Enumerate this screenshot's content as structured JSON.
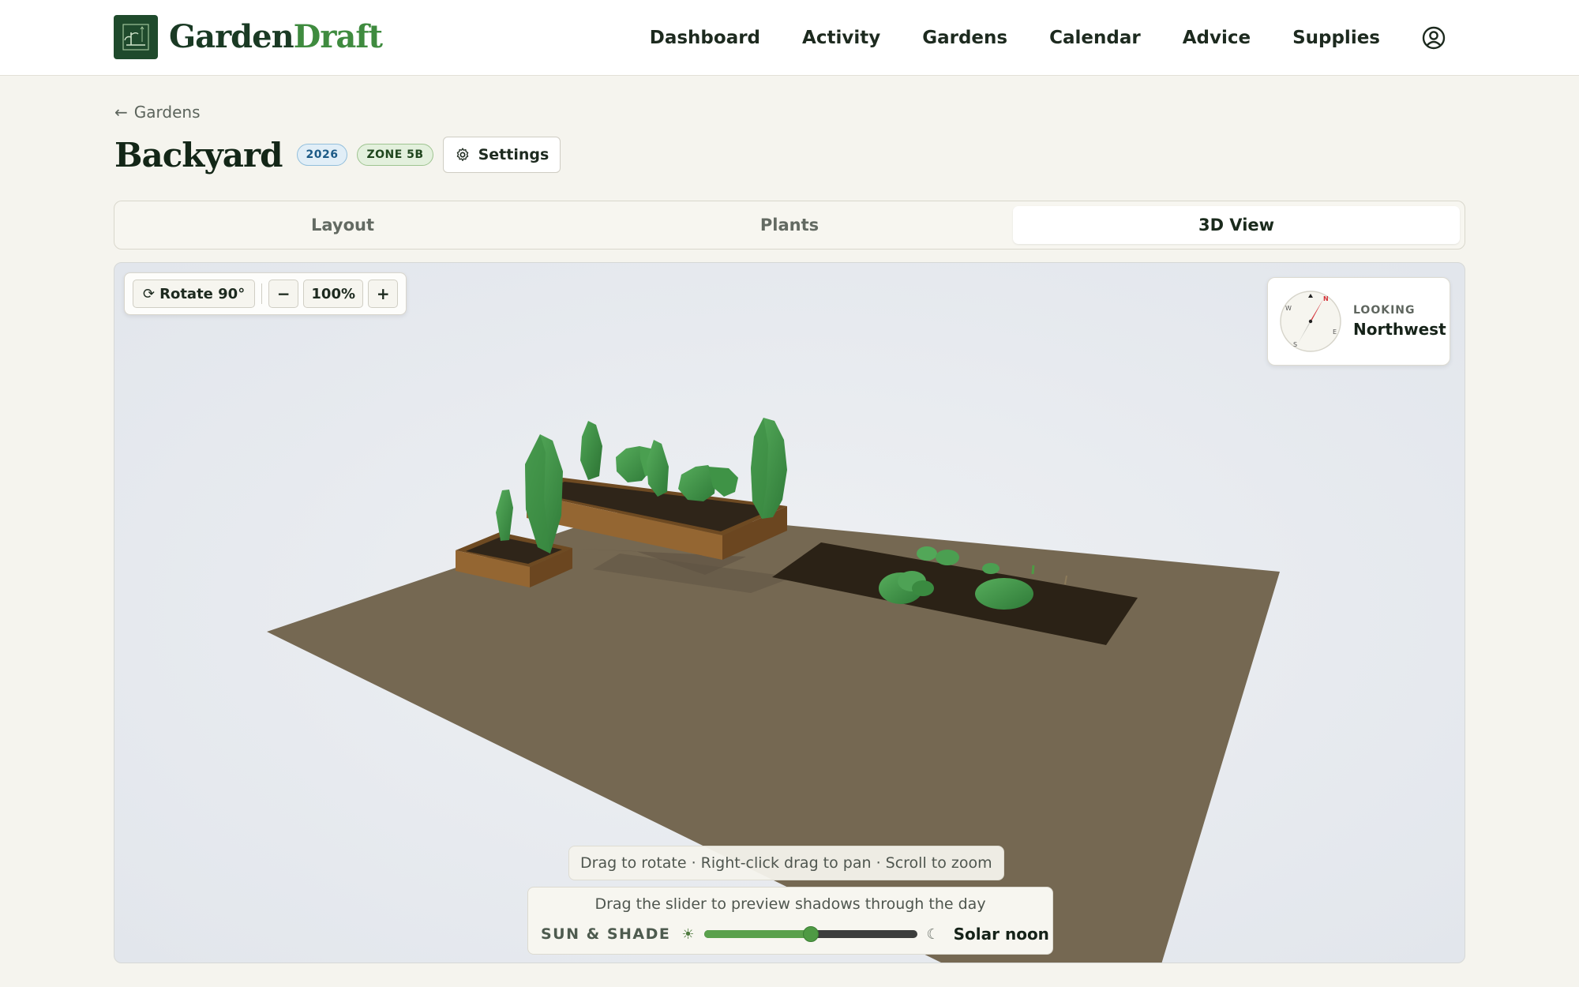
{
  "brand": {
    "name_part1": "Garden",
    "name_part2": "Draft"
  },
  "nav": {
    "items": [
      {
        "label": "Dashboard"
      },
      {
        "label": "Activity"
      },
      {
        "label": "Gardens"
      },
      {
        "label": "Calendar"
      },
      {
        "label": "Advice"
      },
      {
        "label": "Supplies"
      }
    ],
    "account_icon": "user-circle-icon"
  },
  "breadcrumb": {
    "back_label": "Gardens",
    "icon": "arrow-left-icon"
  },
  "garden": {
    "title": "Backyard",
    "year_badge": "2026",
    "zone_badge": "ZONE 5B",
    "settings_label": "Settings",
    "settings_icon": "gear-icon"
  },
  "tabs": {
    "items": [
      {
        "label": "Layout",
        "active": false
      },
      {
        "label": "Plants",
        "active": false
      },
      {
        "label": "3D View",
        "active": true
      }
    ]
  },
  "viewer": {
    "rotate_label": "Rotate 90°",
    "rotate_icon": "rotate-icon",
    "zoom_out_label": "−",
    "zoom_level": "100%",
    "zoom_in_label": "+",
    "compass": {
      "looking_label": "LOOKING",
      "direction": "Northwest",
      "letters": {
        "n": "N",
        "e": "E",
        "s": "S",
        "w": "W"
      }
    },
    "hint": "Drag to rotate · Right-click drag to pan · Scroll to zoom",
    "sun_shade": {
      "caption": "Drag the slider to preview shadows through the day",
      "label": "SUN & SHADE",
      "time_label": "Solar noon",
      "slider_value": 0.5,
      "sun_icon": "sun-icon",
      "moon_icon": "moon-icon"
    }
  },
  "colors": {
    "brand_dark": "#1a3a24",
    "brand_accent": "#3f8b3f",
    "ground": "#756852",
    "soil": "#2e2418",
    "bed_wood": "#8a6030",
    "plant": "#3f9346",
    "compass_needle": "#d4333a"
  }
}
